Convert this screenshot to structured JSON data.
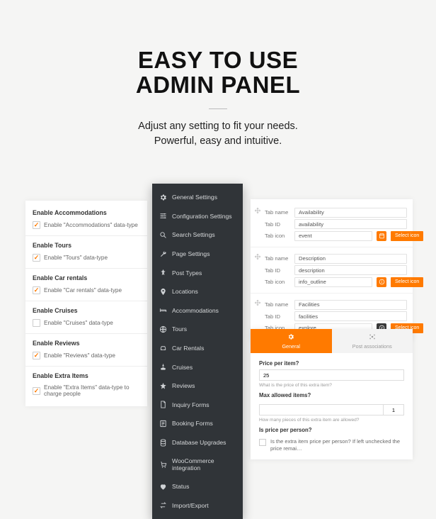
{
  "hero": {
    "title_line1": "EASY TO USE",
    "title_line2": "ADMIN PANEL",
    "subtitle_line1": "Adjust any setting to fit your needs.",
    "subtitle_line2": "Powerful, easy and intuitive."
  },
  "checkbox_panel": [
    {
      "title": "Enable Accommodations",
      "label": "Enable \"Accommodations\" data-type",
      "checked": true
    },
    {
      "title": "Enable Tours",
      "label": "Enable \"Tours\" data-type",
      "checked": true
    },
    {
      "title": "Enable Car rentals",
      "label": "Enable \"Car rentals\" data-type",
      "checked": true
    },
    {
      "title": "Enable Cruises",
      "label": "Enable \"Cruises\" data-type",
      "checked": false
    },
    {
      "title": "Enable Reviews",
      "label": "Enable \"Reviews\" data-type",
      "checked": true
    },
    {
      "title": "Enable Extra Items",
      "label": "Enable \"Extra Items\" data-type to charge people",
      "checked": true
    }
  ],
  "sidebar": {
    "items": [
      {
        "label": "General Settings",
        "icon": "gear"
      },
      {
        "label": "Configuration Settings",
        "icon": "sliders"
      },
      {
        "label": "Search Settings",
        "icon": "search"
      },
      {
        "label": "Page Settings",
        "icon": "wrench"
      },
      {
        "label": "Post Types",
        "icon": "pin"
      },
      {
        "label": "Locations",
        "icon": "marker"
      },
      {
        "label": "Accommodations",
        "icon": "bed"
      },
      {
        "label": "Tours",
        "icon": "globe"
      },
      {
        "label": "Car Rentals",
        "icon": "car"
      },
      {
        "label": "Cruises",
        "icon": "ship"
      },
      {
        "label": "Reviews",
        "icon": "star"
      },
      {
        "label": "Inquiry Forms",
        "icon": "file"
      },
      {
        "label": "Booking Forms",
        "icon": "form"
      },
      {
        "label": "Database Upgrades",
        "icon": "db"
      },
      {
        "label": "WooCommerce integration",
        "icon": "cart"
      },
      {
        "label": "Status",
        "icon": "heart"
      },
      {
        "label": "Import/Export",
        "icon": "transfer"
      }
    ]
  },
  "tab_cards": {
    "select_icon_label": "Select icon",
    "labels": {
      "name": "Tab name",
      "id": "Tab ID",
      "icon": "Tab icon"
    },
    "rows": [
      {
        "name": "Availability",
        "id": "availability",
        "icon": "event",
        "iconStyle": "orange",
        "iconGlyph": "calendar"
      },
      {
        "name": "Description",
        "id": "description",
        "icon": "info_outline",
        "iconStyle": "orange",
        "iconGlyph": "info"
      },
      {
        "name": "Facilities",
        "id": "facilities",
        "icon": "explore",
        "iconStyle": "dark",
        "iconGlyph": "compass"
      }
    ]
  },
  "price_panel": {
    "tabs": {
      "active": "General",
      "inactive": "Post associations"
    },
    "price_label": "Price per item?",
    "price_value": "25",
    "price_hint": "What is the price of this extra item?",
    "max_label": "Max allowed items?",
    "max_value": "1",
    "max_hint": "How many pieces of this extra item are allowed?",
    "per_person_label": "Is price per person?",
    "per_person_text": "Is the extra item price per person? If left unchecked the price remai…"
  }
}
